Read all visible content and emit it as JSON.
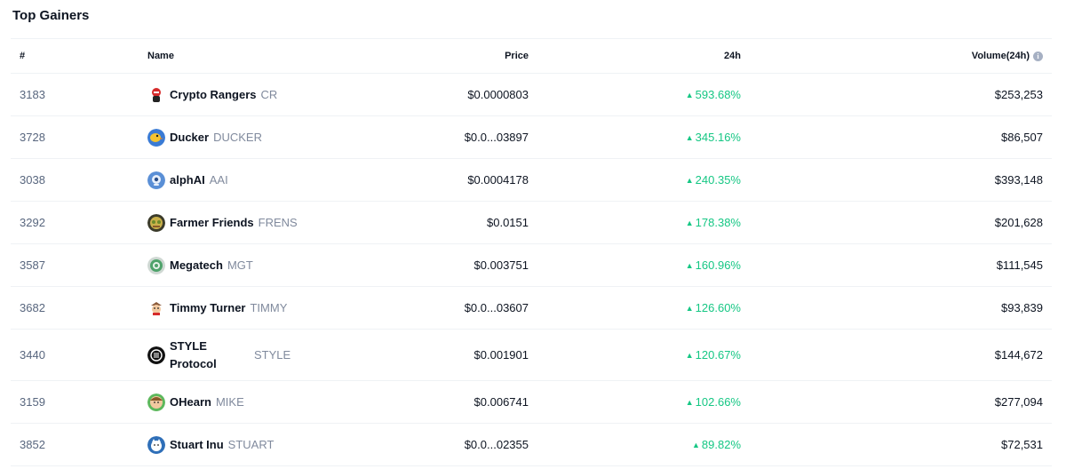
{
  "title": "Top Gainers",
  "columns": {
    "rank": "#",
    "name": "Name",
    "price": "Price",
    "change": "24h",
    "volume": "Volume(24h)"
  },
  "rows": [
    {
      "rank": "3183",
      "name": "Crypto Rangers",
      "symbol": "CR",
      "price": "$0.0000803",
      "change": "593.68%",
      "volume": "$253,253",
      "logo": "crypto-rangers-logo",
      "color": "#d62b2b"
    },
    {
      "rank": "3728",
      "name": "Ducker",
      "symbol": "DUCKER",
      "price": "$0.0...03897",
      "change": "345.16%",
      "volume": "$86,507",
      "logo": "ducker-logo",
      "color": "#3a7bd5"
    },
    {
      "rank": "3038",
      "name": "alphAI",
      "symbol": "AAI",
      "price": "$0.0004178",
      "change": "240.35%",
      "volume": "$393,148",
      "logo": "alphai-logo",
      "color": "#5a8fd6"
    },
    {
      "rank": "3292",
      "name": "Farmer Friends",
      "symbol": "FRENS",
      "price": "$0.0151",
      "change": "178.38%",
      "volume": "$201,628",
      "logo": "farmer-friends-logo",
      "color": "#7a8a3a"
    },
    {
      "rank": "3587",
      "name": "Megatech",
      "symbol": "MGT",
      "price": "$0.003751",
      "change": "160.96%",
      "volume": "$111,545",
      "logo": "megatech-logo",
      "color": "#4fa36b"
    },
    {
      "rank": "3682",
      "name": "Timmy Turner",
      "symbol": "TIMMY",
      "price": "$0.0...03607",
      "change": "126.60%",
      "volume": "$93,839",
      "logo": "timmy-turner-logo",
      "color": "#8a5a3a"
    },
    {
      "rank": "3440",
      "name_line1": "STYLE",
      "name_line2": "Protocol",
      "symbol": "STYLE",
      "price": "$0.001901",
      "change": "120.67%",
      "volume": "$144,672",
      "logo": "style-protocol-logo",
      "color": "#111111"
    },
    {
      "rank": "3159",
      "name": "OHearn",
      "symbol": "MIKE",
      "price": "$0.006741",
      "change": "102.66%",
      "volume": "$277,094",
      "logo": "ohearn-logo",
      "color": "#5cb85c"
    },
    {
      "rank": "3852",
      "name": "Stuart Inu",
      "symbol": "STUART",
      "price": "$0.0...02355",
      "change": "89.82%",
      "volume": "$72,531",
      "logo": "stuart-inu-logo",
      "color": "#2f6fb8"
    }
  ],
  "colors": {
    "up": "#16c784",
    "muted": "#808a9d",
    "text": "#0d1421"
  }
}
